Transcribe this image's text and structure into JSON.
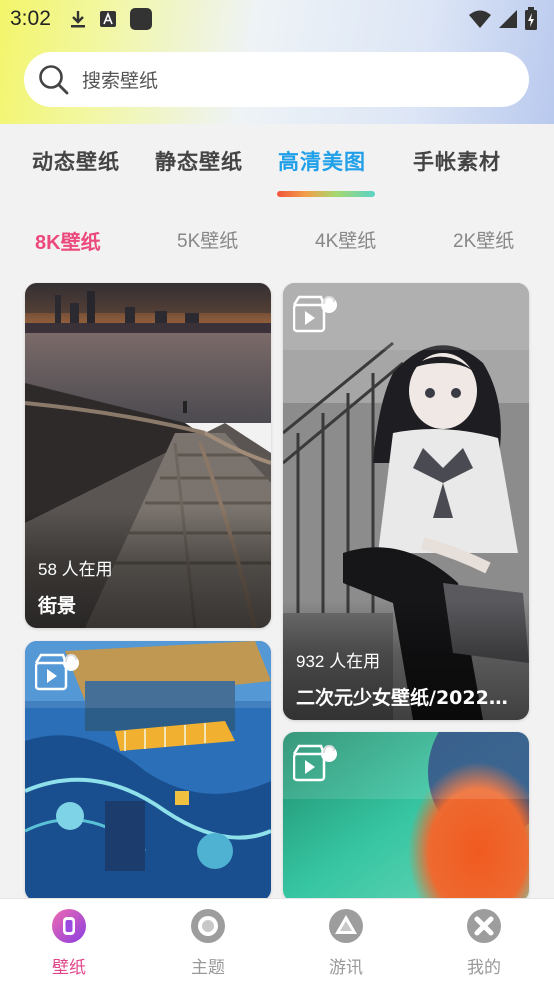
{
  "status_bar": {
    "time": "3:02"
  },
  "search": {
    "placeholder": "搜索壁纸"
  },
  "tabs": [
    {
      "label": "动态壁纸",
      "active": false
    },
    {
      "label": "静态壁纸",
      "active": false
    },
    {
      "label": "高清美图",
      "active": true
    },
    {
      "label": "手帐素材",
      "active": false
    }
  ],
  "subtabs": [
    {
      "label": "8K壁纸",
      "active": true
    },
    {
      "label": "5K壁纸",
      "active": false
    },
    {
      "label": "4K壁纸",
      "active": false
    },
    {
      "label": "2K壁纸",
      "active": false
    }
  ],
  "cards": [
    {
      "users": "58 人在用",
      "title": "街景"
    },
    {
      "users": "932 人在用",
      "title": "二次元少女壁纸/20220..."
    },
    {
      "users": "",
      "title": ""
    },
    {
      "users": "",
      "title": ""
    }
  ],
  "bottom_nav": [
    {
      "label": "壁纸",
      "icon": "wallpaper-icon",
      "active": true
    },
    {
      "label": "主题",
      "icon": "theme-icon",
      "active": false
    },
    {
      "label": "游讯",
      "icon": "game-icon",
      "active": false
    },
    {
      "label": "我的",
      "icon": "profile-icon",
      "active": false
    }
  ],
  "colors": {
    "accent_blue": "#20a0e8",
    "accent_pink": "#ec4a7c",
    "nav_active": "#e0458a"
  }
}
